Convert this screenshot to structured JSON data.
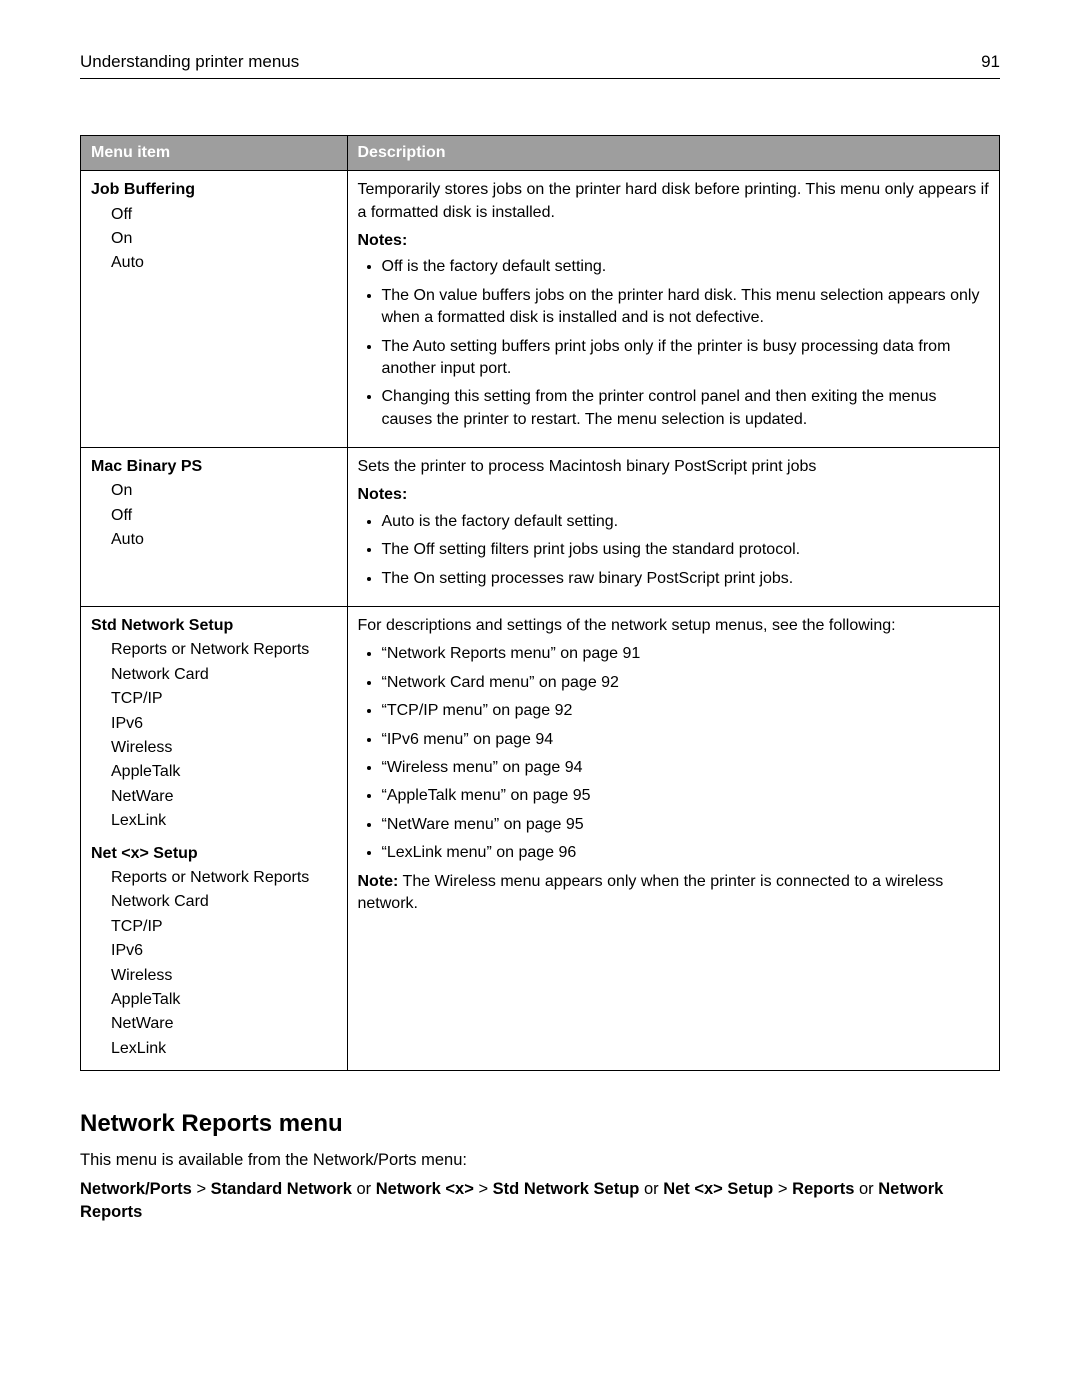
{
  "header": {
    "title": "Understanding printer menus",
    "page_number": "91"
  },
  "table": {
    "col_menu": "Menu item",
    "col_desc": "Description",
    "rows": [
      {
        "title": "Job Buffering",
        "opts": [
          "Off",
          "On",
          "Auto"
        ],
        "intro": "Temporarily stores jobs on the printer hard disk before printing. This menu only appears if a formatted disk is installed.",
        "notes_label": "Notes:",
        "notes": [
          "Off is the factory default setting.",
          "The On value buffers jobs on the printer hard disk. This menu selection appears only when a formatted disk is installed and is not defective.",
          "The Auto setting buffers print jobs only if the printer is busy processing data from another input port.",
          "Changing this setting from the printer control panel and then exiting the menus causes the printer to restart. The menu selection is updated."
        ]
      },
      {
        "title": "Mac Binary PS",
        "opts": [
          "On",
          "Off",
          "Auto"
        ],
        "intro": "Sets the printer to process Macintosh binary PostScript print jobs",
        "notes_label": "Notes:",
        "notes": [
          "Auto is the factory default setting.",
          "The Off setting filters print jobs using the standard protocol.",
          "The On setting processes raw binary PostScript print jobs."
        ]
      }
    ],
    "row3": {
      "groups": [
        {
          "title": "Std Network Setup",
          "opts": [
            "Reports or Network Reports",
            "Network Card",
            "TCP/IP",
            "IPv6",
            "Wireless",
            "AppleTalk",
            "NetWare",
            "LexLink"
          ]
        },
        {
          "title": "Net <x> Setup",
          "opts": [
            "Reports or Network Reports",
            "Network Card",
            "TCP/IP",
            "IPv6",
            "Wireless",
            "AppleTalk",
            "NetWare",
            "LexLink"
          ]
        }
      ],
      "intro": "For descriptions and settings of the network setup menus, see the following:",
      "links": [
        "“Network Reports menu” on page 91",
        "“Network Card menu” on page 92",
        "“TCP/IP menu” on page 92",
        "“IPv6 menu” on page 94",
        "“Wireless menu” on page 94",
        "“AppleTalk menu” on page 95",
        "“NetWare menu” on page 95",
        "“LexLink menu” on page 96"
      ],
      "note_label": "Note:",
      "note_text": " The Wireless menu appears only when the printer is connected to a wireless network."
    }
  },
  "section": {
    "heading": "Network Reports menu",
    "intro": "This menu is available from the Network/Ports menu:",
    "crumb": {
      "p1": "Network/Ports",
      "gt1": " > ",
      "p2": "Standard Network",
      "or1": " or ",
      "p3": "Network <x>",
      "gt2": " > ",
      "p4": "Std Network Setup",
      "or2": " or ",
      "p5": "Net <x> Setup",
      "gt3": " > ",
      "p6": "Reports",
      "or3": " or ",
      "p7": "Network Reports"
    }
  }
}
